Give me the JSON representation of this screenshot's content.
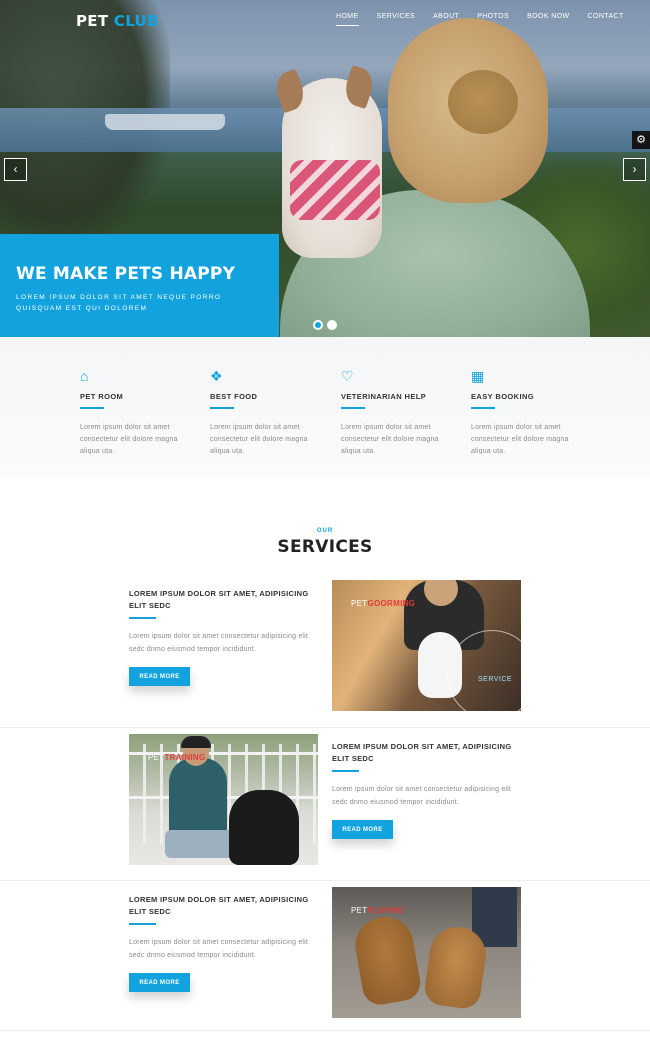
{
  "header": {
    "brand_part1": "PET",
    "brand_part2": "CLUB",
    "nav": [
      "HOME",
      "SERVICES",
      "ABOUT",
      "PHOTOS",
      "BOOK NOW",
      "CONTACT"
    ],
    "active_nav": "HOME"
  },
  "hero": {
    "title": "WE MAKE PETS HAPPY",
    "text": "LOREM IPSUM DOLOR SIT AMET NEQUE PORRO QUISQUAM EST QUI DOLOREM",
    "prev_arrow": "‹",
    "next_arrow": "›",
    "slides_total": 2,
    "active_slide": 1,
    "accent_color": "#12a3df"
  },
  "features": [
    {
      "icon": "home-icon",
      "glyph": "⌂",
      "title": "PET ROOM",
      "text": "Lorem ipsum dolor sit amet consectetur elit dolore magna aliqua uta."
    },
    {
      "icon": "cubes-icon",
      "glyph": "❖",
      "title": "BEST FOOD",
      "text": "Lorem ipsum dolor sit amet consectetur elit dolore magna aliqua uta."
    },
    {
      "icon": "heart-icon",
      "glyph": "♡",
      "title": "VETERINARIAN HELP",
      "text": "Lorem ipsum dolor sit amet consectetur elit dolore magna aliqua uta."
    },
    {
      "icon": "calendar-icon",
      "glyph": "▦",
      "title": "EASY BOOKING",
      "text": "Lorem ipsum dolor sit amet consectetur elit dolore magna aliqua uta."
    }
  ],
  "services": {
    "subtitle": "OUR",
    "title": "SERVICES",
    "items": [
      {
        "heading": "LOREM IPSUM DOLOR SIT AMET, ADIPISICING ELIT SEDC",
        "text": "Lorem ipsum dolor sit amet consectetur adipisicing elit sedc dnmo eiusmod tempor incididunt.",
        "button": "READ MORE",
        "image_label_white": "PET",
        "image_label_red": "GOORMING",
        "image_extra": "SERVICE"
      },
      {
        "heading": "LOREM IPSUM DOLOR SIT AMET, ADIPISICING ELIT SEDC",
        "text": "Lorem ipsum dolor sit amet consectetur adipisicing elit sedc dnmo eiusmod tempor incididunt.",
        "button": "READ MORE",
        "image_label_white": "PET",
        "image_label_red": "TRAINING"
      },
      {
        "heading": "LOREM IPSUM DOLOR SIT AMET, ADIPISICING ELIT SEDC",
        "text": "Lorem ipsum dolor sit amet consectetur adipisicing elit sedc dnmo eiusmod tempor incididunt.",
        "button": "READ MORE",
        "image_label_white": "PET",
        "image_label_red": "PLAYING"
      }
    ]
  },
  "settings_icon": "gear-icon"
}
